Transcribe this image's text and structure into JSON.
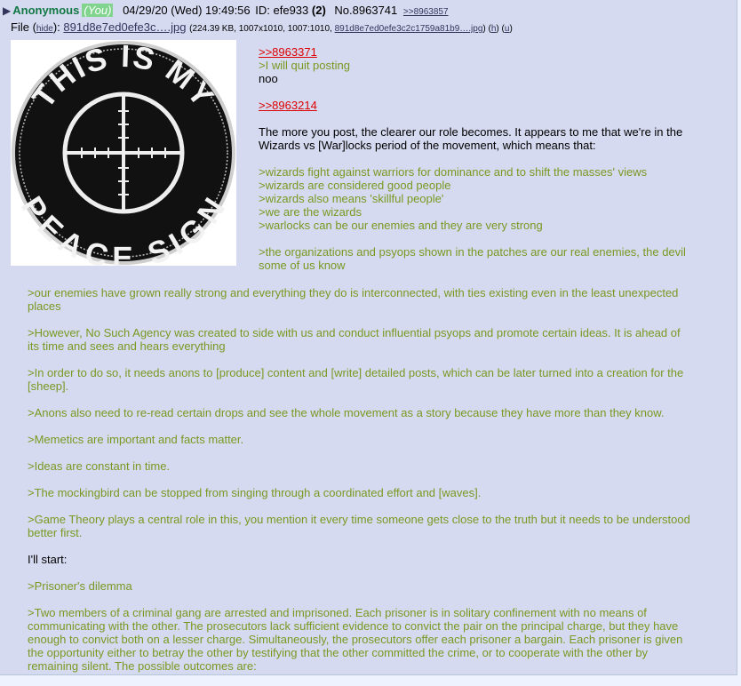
{
  "post": {
    "name": "Anonymous",
    "you": "(You)",
    "datetime": "04/29/20 (Wed) 19:49:56",
    "id_label": "ID: efe933",
    "id_count": "(2)",
    "post_no": "No.8963741",
    "backlink": ">>8963857"
  },
  "file": {
    "label": "File",
    "hide": "hide",
    "filename": "891d8e7ed0efe3c….jpg",
    "meta": "224.39 KB, 1007x1010, 1007:1010,",
    "full_name": "891d8e7ed0efe3c2c1759a81b9….jpg",
    "h": "h",
    "u": "u"
  },
  "image": {
    "icon": "crosshair-patch-image",
    "top_text": "THIS IS MY",
    "bottom_text": "PEACE SIGN"
  },
  "message": {
    "ql1": ">>8963371",
    "q1": ">I will quit posting",
    "t1": "noo",
    "ql2": ">>8963214",
    "t2": "The more you post, the clearer our role becomes. It appears to me that we're in the Wizards vs [War]locks period of the movement, which means that:",
    "g1": [
      ">wizards fight against warriors for dominance and to shift the masses' views",
      ">wizards are considered good people",
      ">wizards also means 'skillful people'",
      ">we are the wizards",
      ">warlocks can be our enemies and they are very strong"
    ],
    "q2": ">the organizations and psyops shown in the patches are our real enemies, the devil some of us know",
    "q3": ">our enemies have grown really strong and everything they do is interconnected, with ties existing even in the least unexpected places",
    "q4": ">However, No Such Agency was created to side with us and conduct influential psyops and promote certain ideas. It is ahead of its time and sees and hears everything",
    "q5": ">In order to do so, it needs anons to [produce] content and [write] detailed posts, which can be later turned into a creation for the [sheep].",
    "q6": ">Anons also need to re-read certain drops and see the whole movement as a story because they have more than they know.",
    "q7": ">Memetics are important and facts matter.",
    "q8": ">Ideas are constant in time.",
    "q9": ">The mockingbird can be stopped from singing through a coordinated effort and [waves].",
    "q10": ">Game Theory plays a central role in this, you mention it every time someone gets close to the truth but it needs to be understood better first.",
    "t3": "I'll start:",
    "q11": ">Prisoner's dilemma",
    "q12": ">Two members of a criminal gang are arrested and imprisoned. Each prisoner is in solitary confinement with no means of communicating with the other. The prosecutors lack sufficient evidence to convict the pair on the principal charge, but they have enough to convict both on a lesser charge. Simultaneously, the prosecutors offer each prisoner a bargain. Each prisoner is given the opportunity either to betray the other by testifying that the other committed the crime, or to cooperate with the other by remaining silent. The possible outcomes are:"
  }
}
